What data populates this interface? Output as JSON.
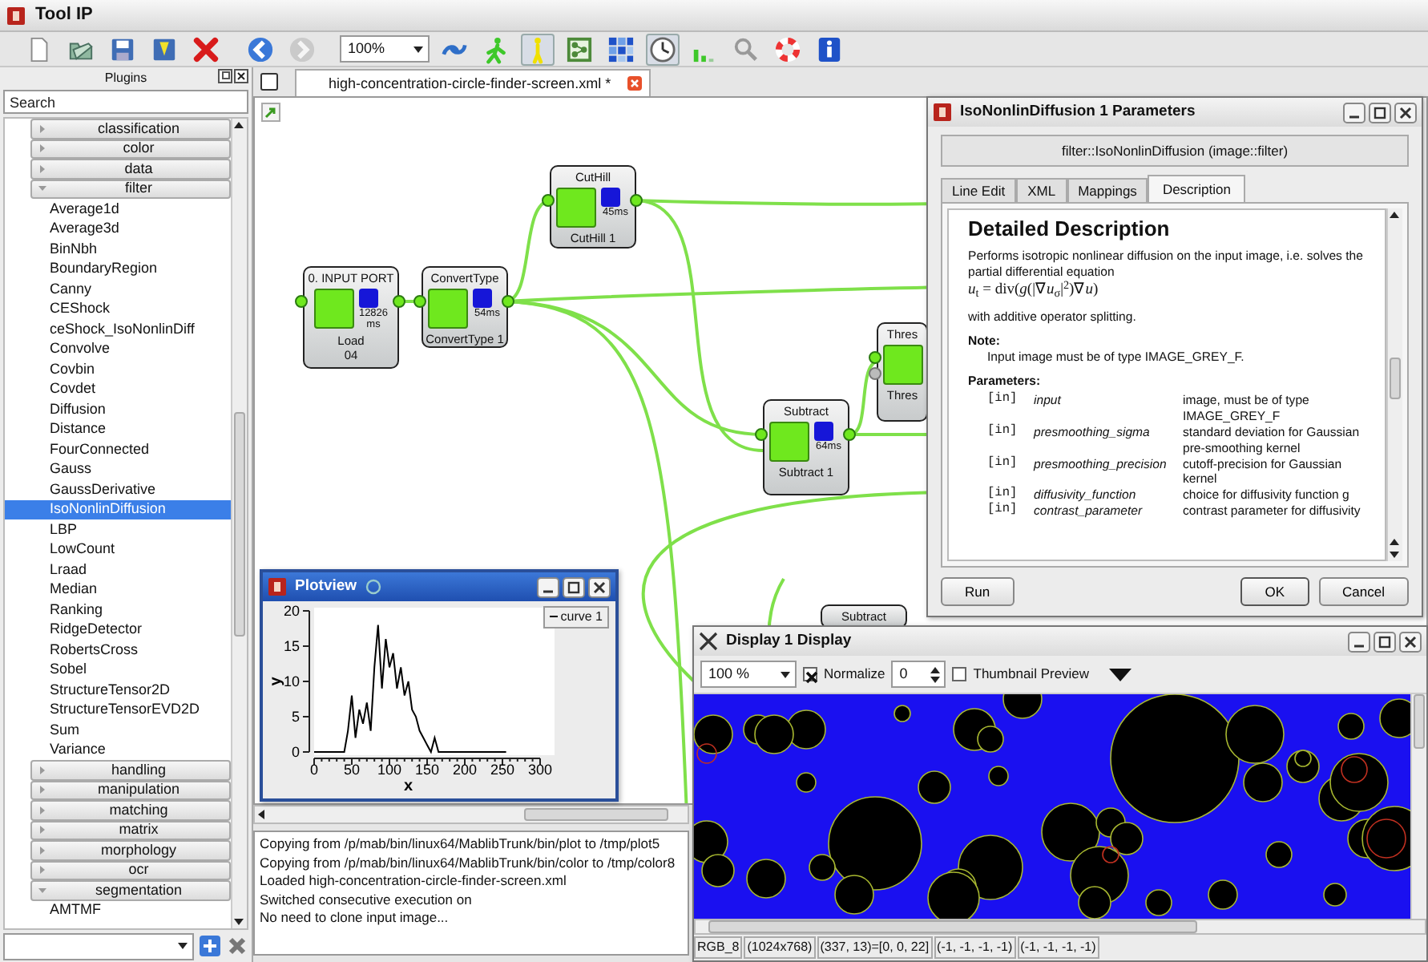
{
  "window": {
    "title": "Tool IP"
  },
  "toolbar": {
    "zoom": "100%",
    "buttons": [
      {
        "kind": "new",
        "pressed": false,
        "disabled": false
      },
      {
        "kind": "open",
        "pressed": false,
        "disabled": false
      },
      {
        "kind": "save",
        "pressed": false,
        "disabled": false
      },
      {
        "kind": "save_as",
        "pressed": false,
        "disabled": false
      },
      {
        "kind": "delete",
        "pressed": false,
        "disabled": false
      },
      {
        "kind": "back",
        "pressed": false,
        "disabled": false
      },
      {
        "kind": "forward",
        "pressed": false,
        "disabled": true
      },
      {
        "kind": "zoom"
      },
      {
        "kind": "link",
        "pressed": false,
        "disabled": false
      },
      {
        "kind": "run",
        "pressed": false,
        "disabled": false
      },
      {
        "kind": "step",
        "pressed": true,
        "disabled": false
      },
      {
        "kind": "graph",
        "pressed": false,
        "disabled": false
      },
      {
        "kind": "grid",
        "pressed": false,
        "disabled": false
      },
      {
        "kind": "clock",
        "pressed": true,
        "disabled": false
      },
      {
        "kind": "bars",
        "pressed": false,
        "disabled": false
      },
      {
        "kind": "search",
        "pressed": false,
        "disabled": false
      },
      {
        "kind": "help",
        "pressed": false,
        "disabled": false
      },
      {
        "kind": "info",
        "pressed": false,
        "disabled": false
      }
    ]
  },
  "plugins": {
    "title": "Plugins",
    "search_placeholder": "Search",
    "categories": [
      {
        "label": "classification",
        "expanded": false
      },
      {
        "label": "color",
        "expanded": false
      },
      {
        "label": "data",
        "expanded": false
      },
      {
        "label": "filter",
        "expanded": true,
        "children": [
          {
            "label": "Average1d",
            "selected": false
          },
          {
            "label": "Average3d",
            "selected": false
          },
          {
            "label": "BinNbh",
            "selected": false
          },
          {
            "label": "BoundaryRegion",
            "selected": false
          },
          {
            "label": "Canny",
            "selected": false
          },
          {
            "label": "CEShock",
            "selected": false
          },
          {
            "label": "ceShock_IsoNonlinDiff",
            "selected": false
          },
          {
            "label": "Convolve",
            "selected": false
          },
          {
            "label": "Covbin",
            "selected": false
          },
          {
            "label": "Covdet",
            "selected": false
          },
          {
            "label": "Diffusion",
            "selected": false
          },
          {
            "label": "Distance",
            "selected": false
          },
          {
            "label": "FourConnected",
            "selected": false
          },
          {
            "label": "Gauss",
            "selected": false
          },
          {
            "label": "GaussDerivative",
            "selected": false
          },
          {
            "label": "IsoNonlinDiffusion",
            "selected": true
          },
          {
            "label": "LBP",
            "selected": false
          },
          {
            "label": "LowCount",
            "selected": false
          },
          {
            "label": "Lraad",
            "selected": false
          },
          {
            "label": "Median",
            "selected": false
          },
          {
            "label": "Ranking",
            "selected": false
          },
          {
            "label": "RidgeDetector",
            "selected": false
          },
          {
            "label": "RobertsCross",
            "selected": false
          },
          {
            "label": "Sobel",
            "selected": false
          },
          {
            "label": "StructureTensor2D",
            "selected": false
          },
          {
            "label": "StructureTensorEVD2D",
            "selected": false
          },
          {
            "label": "Sum",
            "selected": false
          },
          {
            "label": "Variance",
            "selected": false
          }
        ]
      },
      {
        "label": "handling",
        "expanded": false
      },
      {
        "label": "manipulation",
        "expanded": false
      },
      {
        "label": "matching",
        "expanded": false
      },
      {
        "label": "matrix",
        "expanded": false
      },
      {
        "label": "morphology",
        "expanded": false
      },
      {
        "label": "ocr",
        "expanded": false
      },
      {
        "label": "segmentation",
        "expanded": true,
        "children": [
          {
            "label": "AMTMF",
            "selected": false
          }
        ]
      }
    ]
  },
  "tabs": [
    {
      "label": "high-concentration-circle-finder-screen.xml *",
      "selected": true
    }
  ],
  "nodes": [
    {
      "title": "0. INPUT PORT",
      "time": "12826 ms",
      "labels": [
        "Load",
        "04"
      ]
    },
    {
      "title": "ConvertType",
      "time": "54ms",
      "labels": [
        "ConvertType 1"
      ]
    },
    {
      "title": "CutHill",
      "time": "45ms",
      "labels": [
        "CutHill 1"
      ]
    },
    {
      "title": "Subtract",
      "time": "64ms",
      "labels": [
        "Subtract 1"
      ]
    },
    {
      "title": "Thres",
      "labels": [
        "Thres"
      ]
    },
    {
      "title": "Subtract"
    }
  ],
  "log": [
    "Copying from /p/mab/bin/linux64/MablibTrunk/bin/plot to /tmp/plot5",
    "Copying from /p/mab/bin/linux64/MablibTrunk/bin/color to /tmp/color8",
    "Loaded high-concentration-circle-finder-screen.xml",
    "Switched consecutive execution on",
    "No need to clone input image..."
  ],
  "plotview": {
    "title": "Plotview",
    "chart_data": {
      "type": "line",
      "xlabel": "x",
      "ylabel": "y",
      "xlim": [
        0,
        300
      ],
      "ylim": [
        0,
        20
      ],
      "xticks": [
        0,
        50,
        100,
        150,
        200,
        250,
        300
      ],
      "yticks": [
        0,
        5,
        10,
        15,
        20
      ],
      "x": [
        0,
        5,
        10,
        15,
        20,
        25,
        30,
        35,
        40,
        45,
        50,
        55,
        60,
        65,
        70,
        75,
        80,
        85,
        90,
        95,
        100,
        105,
        110,
        115,
        120,
        125,
        130,
        135,
        140,
        145,
        150,
        155,
        160,
        165,
        170,
        175,
        180,
        185,
        190,
        195,
        200,
        205,
        210,
        215,
        220,
        225,
        230,
        235,
        240,
        245,
        250,
        255
      ],
      "series": [
        {
          "name": "curve 1",
          "color": "#000000",
          "values": [
            0,
            0,
            0,
            0,
            0,
            0,
            0,
            0,
            0,
            3,
            8,
            2,
            6,
            4,
            7,
            3,
            12,
            18,
            9,
            16,
            12,
            14,
            9,
            12,
            8,
            10,
            6,
            5,
            3,
            2,
            1,
            0,
            2,
            0,
            0,
            0,
            0,
            0,
            0,
            0,
            0,
            0,
            0,
            0,
            0,
            0,
            0,
            0,
            0,
            0,
            0,
            0
          ]
        }
      ]
    }
  },
  "parameters_dialog": {
    "title": "IsoNonlinDiffusion 1 Parameters",
    "filter": "filter::IsoNonlinDiffusion (image::filter)",
    "tabs": [
      {
        "label": "Line Edit",
        "selected": false
      },
      {
        "label": "XML",
        "selected": false
      },
      {
        "label": "Mappings",
        "selected": false
      },
      {
        "label": "Description",
        "selected": true
      }
    ],
    "description": {
      "heading": "Detailed Description",
      "intro": "Performs isotropic nonlinear diffusion on the input image, i.e. solves the partial differential equation",
      "formula": "*u*$_{t}$ = div(*g*(|∇*u*$_{σ}$|$^{2}$)∇*u*)",
      "after": "with additive operator splitting.",
      "note_label": "Note:",
      "note": "Input image must be of type IMAGE_GREY_F.",
      "params_label": "Parameters:",
      "params": [
        {
          "direction": "[in]",
          "name": "input",
          "text": "image, must be of type IMAGE_GREY_F"
        },
        {
          "direction": "[in]",
          "name": "presmoothing_sigma",
          "text": "standard deviation for Gaussian pre-smoothing kernel"
        },
        {
          "direction": "[in]",
          "name": "presmoothing_precision",
          "text": "cutoff-precision for Gaussian kernel"
        },
        {
          "direction": "[in]",
          "name": "diffusivity_function",
          "text": "choice for diffusivity function g"
        },
        {
          "direction": "[in]",
          "name": "contrast_parameter",
          "text": "contrast parameter for diffusivity"
        }
      ]
    },
    "buttons": [
      {
        "label": "Run",
        "kind": "plain"
      },
      {
        "label": "OK",
        "kind": "default"
      },
      {
        "label": "Cancel",
        "kind": "plain"
      }
    ]
  },
  "display": {
    "title": "Display 1 Display",
    "zoom": "100 %",
    "normalize": {
      "label": "Normalize",
      "checked": true
    },
    "spin_value": "0",
    "thumbnail": {
      "label": "Thumbnail Preview",
      "checked": false
    },
    "status": [
      "RGB_8",
      "(1024x768)",
      "(337, 13)=[0, 0, 22]",
      "(-1, -1, -1, -1)",
      "(-1, -1, -1, -1)"
    ]
  }
}
